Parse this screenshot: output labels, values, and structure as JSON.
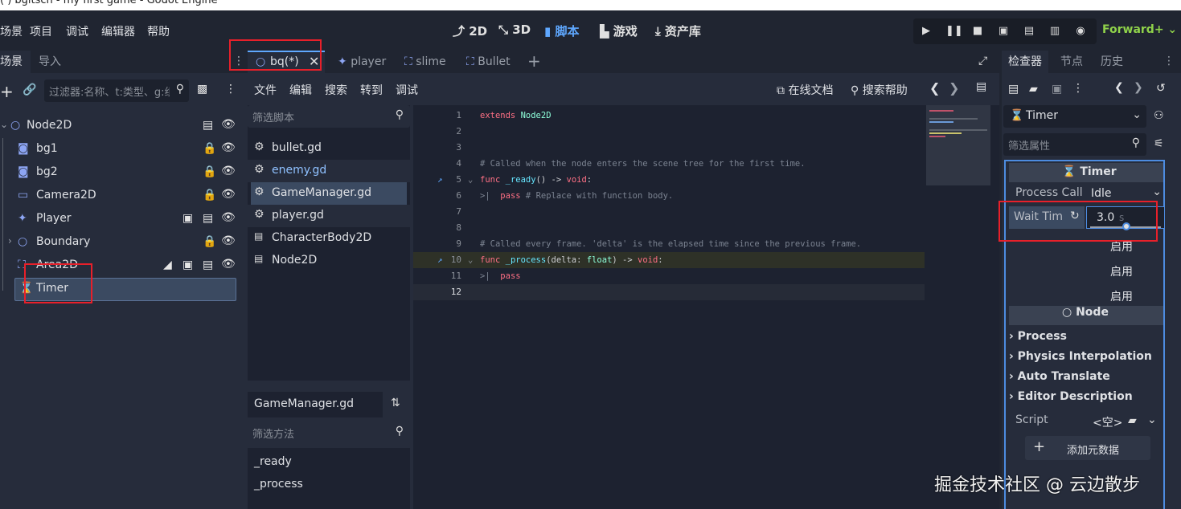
{
  "window_title": "( ) bgitsch - my first game - Godot Engine",
  "menus": [
    "场景",
    "项目",
    "调试",
    "编辑器",
    "帮助"
  ],
  "modes": {
    "m2d": "2D",
    "m3d": "3D",
    "script": "脚本",
    "game": "游戏",
    "assetlib": "资产库"
  },
  "renderer": "Forward+",
  "scene_dock": {
    "tabs": {
      "scene": "场景",
      "import": "导入"
    },
    "filter_placeholder": "过滤器:名称、t:类型、g:组",
    "nodes": {
      "root": "Node2D",
      "bg1": "bg1",
      "bg2": "bg2",
      "camera": "Camera2D",
      "player": "Player",
      "boundary": "Boundary",
      "area": "Area2D",
      "timer": "Timer"
    }
  },
  "editor_tabs": {
    "bq": "bq(*)",
    "player": "player",
    "slime": "slime",
    "bullet": "Bullet"
  },
  "script_menu": {
    "file": "文件",
    "edit": "编辑",
    "search": "搜索",
    "goto": "转到",
    "debug": "调试",
    "online_docs": "在线文档",
    "search_help": "搜索帮助"
  },
  "script_list": {
    "filter_placeholder": "筛选脚本",
    "items": {
      "bullet": "bullet.gd",
      "enemy": "enemy.gd",
      "gamemanager": "GameManager.gd",
      "player": "player.gd",
      "charbody": "CharacterBody2D",
      "node2d": "Node2D"
    },
    "current": "GameManager.gd",
    "methods_placeholder": "筛选方法",
    "methods": {
      "ready": "_ready",
      "process": "_process"
    }
  },
  "code": {
    "line_numbers": [
      "1",
      "2",
      "3",
      "4",
      "5",
      "6",
      "7",
      "8",
      "9",
      "10",
      "11",
      "12"
    ],
    "l1a": "extends",
    "l1b": "Node2D",
    "l4": "# Called when the node enters the scene tree for the first time.",
    "l5a": "func",
    "l5b": "_ready",
    "l5c": "() -> ",
    "l5d": "void",
    ":": ":",
    "l6a": "pass",
    "l6b": "# Replace with function body.",
    "l9": "# Called every frame. 'delta' is the elapsed time since the previous frame.",
    "l10a": "func",
    "l10b": "_process",
    "l10c": "(delta: ",
    "l10d": "float",
    "l10e": ") -> ",
    "l10f": "void",
    "l10g": ":",
    "l11": "pass"
  },
  "inspector": {
    "tabs": {
      "inspector": "检查器",
      "node": "节点",
      "history": "历史"
    },
    "object": "Timer",
    "filter_placeholder": "筛选属性",
    "class_header": "Timer",
    "process_callback_label": "Process Call",
    "process_callback_value": "Idle",
    "wait_time_label": "Wait Tim",
    "wait_time_value": "3.0",
    "wait_time_unit": "s",
    "enabled": [
      "启用",
      "启用",
      "启用"
    ],
    "node_header": "Node",
    "sections": {
      "process": "Process",
      "physics": "Physics Interpolation",
      "translate": "Auto Translate",
      "desc": "Editor Description"
    },
    "script_label": "Script",
    "script_value": "<空>",
    "add_metadata": "添加元数据"
  },
  "watermark": "掘金技术社区 @ 云边散步"
}
